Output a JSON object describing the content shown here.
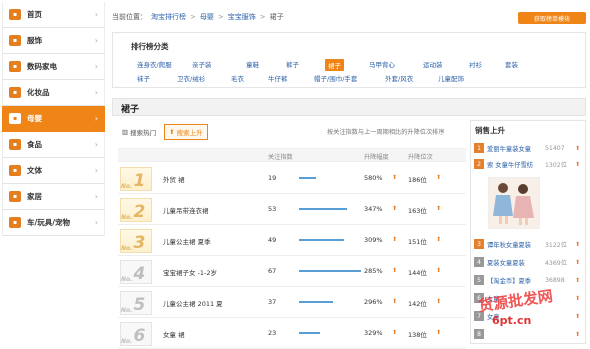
{
  "sidebar": {
    "items": [
      {
        "label": "首页",
        "icon": "home-icon"
      },
      {
        "label": "服饰",
        "icon": "clothes-icon"
      },
      {
        "label": "数码家电",
        "icon": "digital-icon"
      },
      {
        "label": "化妆品",
        "icon": "cosmetics-icon"
      },
      {
        "label": "母婴",
        "icon": "baby-icon",
        "active": true
      },
      {
        "label": "食品",
        "icon": "food-icon"
      },
      {
        "label": "文体",
        "icon": "sports-icon"
      },
      {
        "label": "家居",
        "icon": "home-goods-icon"
      },
      {
        "label": "车/玩具/宠物",
        "icon": "car-icon"
      }
    ]
  },
  "breadcrumb": {
    "prefix": "当前位置：",
    "items": [
      "淘宝排行榜",
      "母婴",
      "宝宝服饰",
      "裙子"
    ],
    "sep": ">"
  },
  "top_button": "获取榜单模块",
  "categories": {
    "title": "排行榜分类",
    "row1": [
      "连身衣/爬服",
      "亲子装",
      "童鞋",
      "裤子",
      "裙子",
      "马甲背心",
      "运动装",
      "衬衫",
      "套装"
    ],
    "row2": [
      "袜子",
      "卫衣/绒衫",
      "毛衣",
      "牛仔裤",
      "帽子/围巾/手套",
      "外套/风衣",
      "儿童配饰"
    ],
    "selected": "裙子"
  },
  "section_title": "裙子",
  "tabs": [
    {
      "label": "搜索热门",
      "icon": "chart-icon"
    },
    {
      "label": "搜索上升",
      "icon": "up-arrow-icon",
      "active": true
    }
  ],
  "note": "按关注指数与上一周期相比的升降位次排序",
  "table": {
    "headers": [
      "关注指数",
      "升降幅度",
      "升降位次"
    ],
    "rows": [
      {
        "no": "No.",
        "rank": "1",
        "kw": "外贸 裙",
        "idx": "19",
        "level": 0.28,
        "pct": "580%",
        "pos": "186位",
        "tier": "gold"
      },
      {
        "no": "No.",
        "rank": "2",
        "kw": "儿童吊带连衣裙",
        "idx": "53",
        "level": 0.78,
        "pct": "347%",
        "pos": "163位",
        "tier": "gold"
      },
      {
        "no": "No.",
        "rank": "3",
        "kw": "儿童公主裙 夏季",
        "idx": "49",
        "level": 0.72,
        "pct": "309%",
        "pos": "151位",
        "tier": "gold"
      },
      {
        "no": "No.",
        "rank": "4",
        "kw": "宝宝裙子女 -1-2岁",
        "idx": "67",
        "level": 1.0,
        "pct": "285%",
        "pos": "144位",
        "tier": "gray"
      },
      {
        "no": "No.",
        "rank": "5",
        "kw": "儿童公主裙 2011 夏",
        "idx": "37",
        "level": 0.55,
        "pct": "296%",
        "pos": "142位",
        "tier": "gray"
      },
      {
        "no": "No.",
        "rank": "6",
        "kw": "女童 裙",
        "idx": "23",
        "level": 0.34,
        "pct": "329%",
        "pos": "138位",
        "tier": "gray"
      }
    ]
  },
  "right_panel": {
    "title": "销售上升",
    "items": [
      {
        "n": "1",
        "name": "爱丽牛童装女童",
        "val": "51407",
        "color": "#e5802c"
      },
      {
        "n": "2",
        "name": "索 女童牛仔雪纺",
        "val": "1302位",
        "color": "#e5802c"
      },
      {
        "n": "3",
        "name": "谭年秋女童夏装",
        "val": "3122位",
        "color": "#e5802c"
      },
      {
        "n": "4",
        "name": "夏装女童夏装",
        "val": "4369位",
        "color": "#999"
      },
      {
        "n": "5",
        "name": "【淘金币】夏季",
        "val": "36898",
        "color": "#999"
      },
      {
        "n": "6",
        "name": "女童",
        "val": "",
        "color": "#999"
      },
      {
        "n": "7",
        "name": "女童",
        "val": "",
        "color": "#999"
      },
      {
        "n": "8",
        "name": "",
        "val": "",
        "color": "#999"
      }
    ]
  },
  "watermark": "货源批发网",
  "watermark_url": "6pt.cn"
}
